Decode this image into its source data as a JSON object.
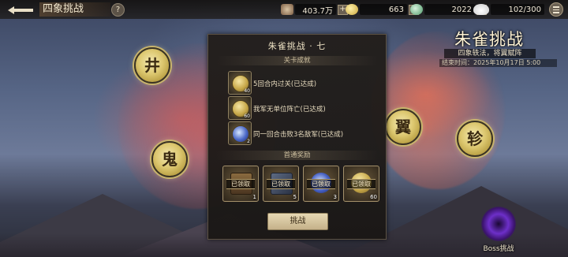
{
  "header": {
    "title": "四象挑战",
    "help_label": "?",
    "resources": [
      {
        "name": "silver-icon",
        "value": "403.7万"
      },
      {
        "name": "gold-coin-icon",
        "value": "663"
      },
      {
        "name": "jade-icon",
        "value": "2022"
      },
      {
        "name": "stamina-icon",
        "value": "102/300"
      }
    ],
    "plus_label": "+"
  },
  "constellations": [
    "井",
    "鬼",
    "翼",
    "轸"
  ],
  "event": {
    "title": "朱雀挑战",
    "subtitle": "四象轶法，将翼赋阵",
    "end_time": "结束时间：2025年10月17日 5:00"
  },
  "panel": {
    "title": "朱雀挑战 · 七",
    "achievements_header": "关卡成就",
    "achievements": [
      {
        "text": "5回合内过关(已达成)",
        "count": "40",
        "icon": "gold-coin-icon"
      },
      {
        "text": "我军无单位阵亡(已达成)",
        "count": "60",
        "icon": "gold-coin-icon"
      },
      {
        "text": "同一回合击败3名敌军(已达成)",
        "count": "2",
        "icon": "blue-orb-icon"
      }
    ],
    "rewards_header": "首通奖励",
    "rewards": [
      {
        "label": "已领取",
        "count": "1",
        "icon": "chest-icon"
      },
      {
        "label": "已领取",
        "count": "5",
        "icon": "scroll-icon"
      },
      {
        "label": "已领取",
        "count": "3",
        "icon": "blue-orb-icon"
      },
      {
        "label": "已领取",
        "count": "60",
        "icon": "gold-coin-icon"
      }
    ],
    "challenge_label": "挑战"
  },
  "boss": {
    "label": "Boss挑战"
  }
}
